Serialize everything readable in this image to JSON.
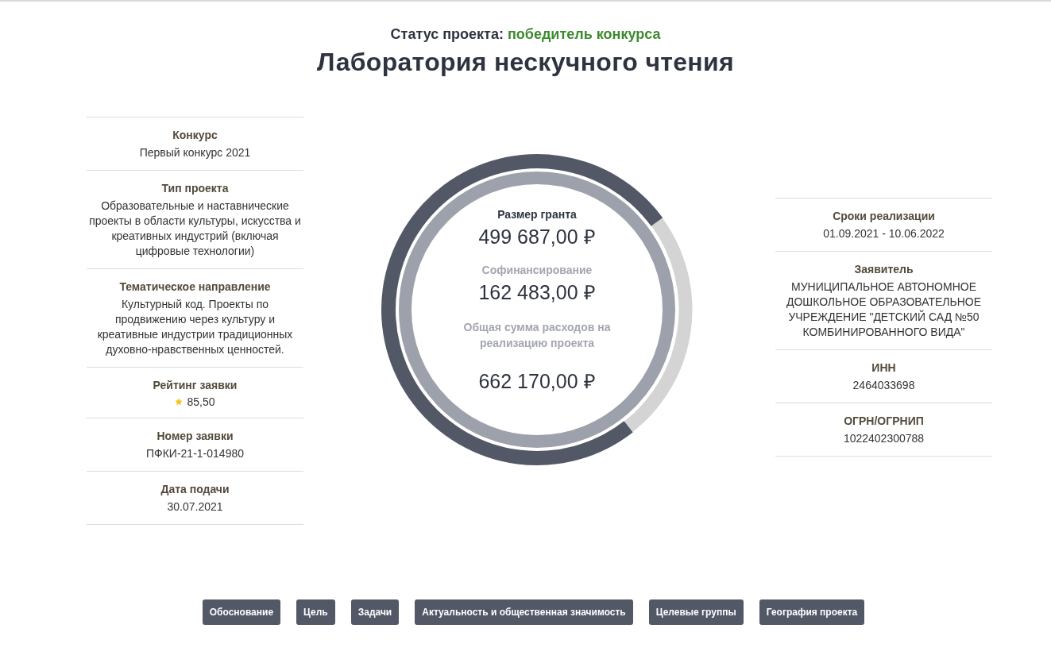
{
  "status": {
    "label": "Статус проекта:",
    "value": "победитель конкурса"
  },
  "title": "Лаборатория нескучного чтения",
  "left_info": [
    {
      "label": "Конкурс",
      "value": "Первый конкурс 2021"
    },
    {
      "label": "Тип проекта",
      "value": "Образовательные и наставнические проекты в области культуры, искусства и креативных индустрий (включая цифровые технологии)"
    },
    {
      "label": "Тематическое направление",
      "value": "Культурный код. Проекты по продвижению через культуру и креативные индустрии традиционных духовно-нравственных ценностей."
    },
    {
      "label": "Рейтинг заявки",
      "value": "85,50",
      "kind": "rating"
    },
    {
      "label": "Номер заявки",
      "value": "ПФКИ-21-1-014980"
    },
    {
      "label": "Дата подачи",
      "value": "30.07.2021"
    }
  ],
  "donut": {
    "chart_data": {
      "type": "donut",
      "values": [
        75.5,
        24.5
      ]
    },
    "grant_label": "Размер гранта",
    "grant_value": "499 687,00 ₽",
    "cofinancing_label": "Софинансирование",
    "cofinancing_value": "162 483,00 ₽",
    "total_label": "Общая сумма расходов на реализацию проекта",
    "total_value": "662 170,00 ₽"
  },
  "right_info": [
    {
      "label": "Сроки реализации",
      "value": "01.09.2021 - 10.06.2022"
    },
    {
      "label": "Заявитель",
      "value": "МУНИЦИПАЛЬНОЕ АВТОНОМНОЕ ДОШКОЛЬНОЕ ОБРАЗОВАТЕЛЬНОЕ УЧРЕЖДЕНИЕ \"ДЕТСКИЙ САД №50 КОМБИНИРОВАННОГО ВИДА\""
    },
    {
      "label": "ИНН",
      "value": "2464033698"
    },
    {
      "label": "ОГРН/ОГРНИП",
      "value": "1022402300788"
    }
  ],
  "buttons": [
    "Обоснование",
    "Цель",
    "Задачи",
    "Актуальность и общественная значимость",
    "Целевые группы",
    "География проекта"
  ]
}
